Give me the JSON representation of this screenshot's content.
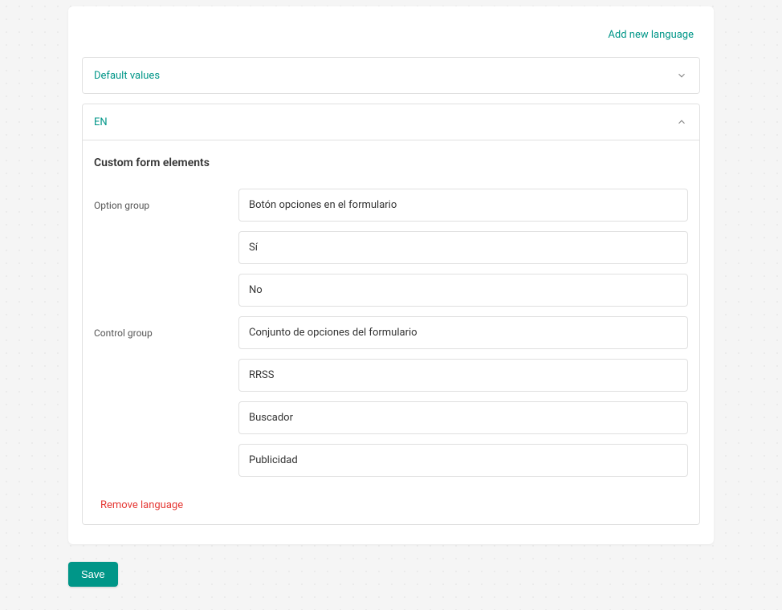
{
  "header": {
    "add_language": "Add new language"
  },
  "accordion": {
    "default_values_title": "Default values",
    "en": {
      "title": "EN",
      "section_title": "Custom form elements",
      "option_group_label": "Option group",
      "option_group_values": [
        "Botón opciones en el formulario",
        "Sí",
        "No"
      ],
      "control_group_label": "Control group",
      "control_group_values": [
        "Conjunto de opciones del formulario",
        "RRSS",
        "Buscador",
        "Publicidad"
      ],
      "remove_language": "Remove language"
    }
  },
  "actions": {
    "save": "Save"
  }
}
